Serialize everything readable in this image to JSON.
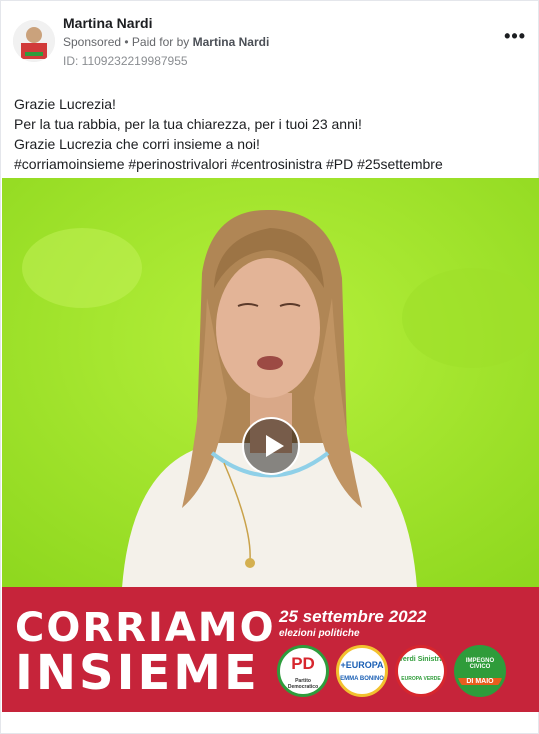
{
  "post": {
    "author": "Martina Nardi",
    "sponsored": "Sponsored",
    "paid_for_prefix": " • Paid for by ",
    "paid_for_name": "Martina Nardi",
    "ad_id": "ID: 1109232219987955",
    "more_label": "•••"
  },
  "text_lines": [
    "Grazie Lucrezia!",
    "Per la tua rabbia, per la tua chiarezza, per i tuoi 23 anni!",
    "Grazie Lucrezia che corri insieme a noi!",
    "#corriamoinsieme #perinostrivalori #centrosinistra #PD #25settembre"
  ],
  "banner": {
    "line1": "CORRIAMO",
    "line2": "INSIEME",
    "date": "25 settembre 2022",
    "subtitle": "elezioni politiche",
    "logos": [
      {
        "top": "PD",
        "bottom": "Partito Democratico",
        "color": "#d7262d"
      },
      {
        "top": "+EUROPA",
        "bottom": "EMMA BONINO",
        "color": "#1a5fb4"
      },
      {
        "top": "Verdi Sinistra",
        "bottom": "EUROPA VERDE",
        "color": "#2f9c3a"
      },
      {
        "top": "IMPEGNO CIVICO",
        "bottom": "DI MAIO",
        "color": "#e85d1e"
      }
    ]
  },
  "colors": {
    "banner_red": "#c6243a",
    "video_bg": "#a6e62d"
  },
  "icons": {
    "play": "play-icon",
    "more": "more-icon"
  }
}
